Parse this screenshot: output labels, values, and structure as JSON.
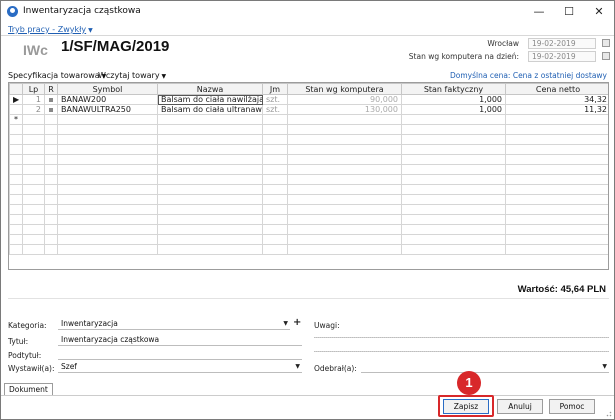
{
  "window": {
    "title": "Inwentaryzacja cząstkowa",
    "controls": {
      "minimize": "—",
      "maximize": "☐",
      "close": "✕"
    }
  },
  "mode": {
    "label": "Tryb pracy - Zwykły"
  },
  "document": {
    "type": "IWc",
    "number": "1/SF/MAG/2019",
    "place": "Wrocław",
    "date": "19-02-2019",
    "stock_date_label": "Stan wg komputera na dzień:",
    "stock_date": "19-02-2019"
  },
  "toolbar": {
    "spec_label": "Specyfikacja towarowa",
    "load_label": "Wczytaj towary",
    "default_price": "Domyślna cena: Cena z ostatniej dostawy"
  },
  "grid": {
    "columns": [
      "Lp",
      "R",
      "Symbol",
      "Nazwa",
      "Jm",
      "Stan wg komputera",
      "Stan faktyczny",
      "Cena netto"
    ],
    "rows": [
      {
        "lp": "1",
        "symbol": "BANAW200",
        "nazwa": "Balsam do ciała nawilżają",
        "jm": "szt.",
        "stan": "90,000",
        "faktyczny": "1,000",
        "cena": "34,32"
      },
      {
        "lp": "2",
        "symbol": "BANAWULTRA250",
        "nazwa": "Balsam do ciała ultranawil",
        "jm": "szt.",
        "stan": "130,000",
        "faktyczny": "1,000",
        "cena": "11,32"
      }
    ],
    "current_row_marker": "▶",
    "new_row_marker": "*"
  },
  "summary": {
    "total": "Wartość: 45,64 PLN"
  },
  "form": {
    "kategoria_label": "Kategoria:",
    "kategoria_value": "Inwentaryzacja",
    "tytul_label": "Tytuł:",
    "tytul_value": "Inwentaryzacja cząstkowa",
    "podtytul_label": "Podtytuł:",
    "podtytul_value": "",
    "wystawil_label": "Wystawił(a):",
    "wystawil_value": "Szef",
    "uwagi_label": "Uwagi:",
    "odebral_label": "Odebrał(a):",
    "odebral_value": ""
  },
  "tabs": [
    "Dokument"
  ],
  "buttons": {
    "save": "Zapisz",
    "cancel": "Anuluj",
    "help": "Pomoc"
  },
  "annotation": {
    "step": "1"
  },
  "colors": {
    "accent": "#2a6cc4",
    "highlight": "#d8282a",
    "link": "#1f5fb3"
  }
}
